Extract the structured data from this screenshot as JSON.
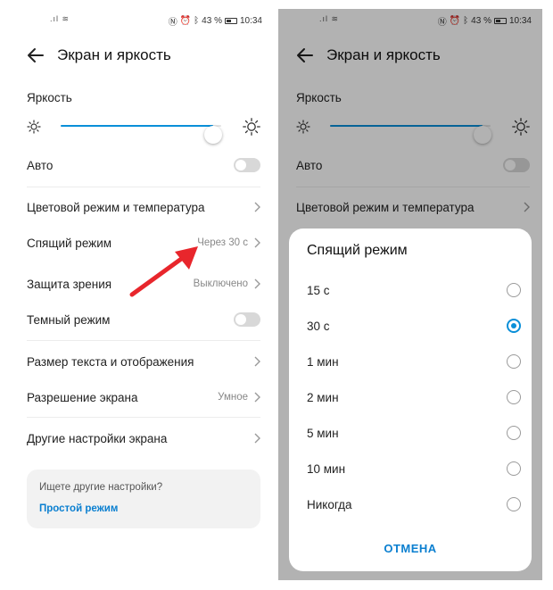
{
  "status_bar": {
    "battery": "43 %",
    "time": "10:34"
  },
  "settings": {
    "title": "Экран и яркость",
    "brightness": {
      "label": "Яркость",
      "level": 0.95
    },
    "auto_label": "Авто",
    "items": [
      {
        "label": "Цветовой режим и температура",
        "value": ""
      },
      {
        "label": "Спящий режим",
        "value": "Через 30 с"
      },
      {
        "label": "Защита зрения",
        "value": "Выключено"
      },
      {
        "label": "Темный режим",
        "value": ""
      },
      {
        "label": "Размер текста и отображения",
        "value": ""
      },
      {
        "label": "Разрешение экрана",
        "value": "Умное"
      },
      {
        "label": "Другие настройки экрана",
        "value": ""
      }
    ],
    "hint": {
      "text": "Ищете другие настройки?",
      "link": "Простой режим"
    }
  },
  "dialog": {
    "title": "Спящий режим",
    "options": [
      "15 с",
      "30 с",
      "1 мин",
      "2 мин",
      "5 мин",
      "10 мин",
      "Никогда"
    ],
    "selected_index": 1,
    "cancel_label": "ОТМЕНА"
  },
  "colors": {
    "accent": "#0a8fd8",
    "link": "#0a7fd0",
    "arrow": "#e8262c"
  },
  "icons": [
    "back-arrow-icon",
    "sun-small-icon",
    "sun-large-icon",
    "chevron-right-icon",
    "signal-icon",
    "wifi-icon",
    "nfc-icon",
    "alarm-icon",
    "bluetooth-icon",
    "battery-icon"
  ]
}
